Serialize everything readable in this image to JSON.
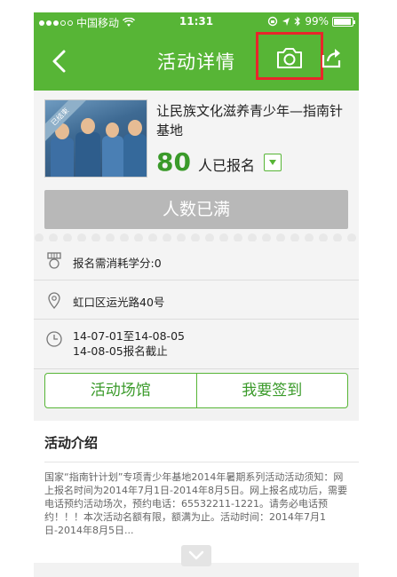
{
  "status_bar": {
    "carrier": "中国移动",
    "time": "11:31",
    "battery": "99%"
  },
  "nav": {
    "title": "活动详情",
    "back_icon": "chevron-left-icon",
    "camera_icon": "camera-icon",
    "share_icon": "share-icon"
  },
  "activity": {
    "thumb_ribbon": "已结束",
    "title": "让民族文化滋养青少年—指南针基地",
    "signup_count": "80",
    "signup_label": "人已报名",
    "full_button": "人数已满"
  },
  "info": {
    "credits": "报名需消耗学分:0",
    "address": "虹口区运光路40号",
    "date_range": "14-07-01至14-08-05",
    "deadline": "14-08-05报名截止"
  },
  "actions": {
    "venue": "活动场馆",
    "checkin": "我要签到"
  },
  "intro": {
    "title": "活动介绍",
    "text": "国家“指南针计划”专项青少年基地2014年暑期系列活动活动须知：网上报名时间为2014年7月1日-2014年8月5日。网上报名成功后，需要电话预约活动场次，预约电话：65532211-1221。请务必电话预约！！！本次活动名额有限，额满为止。活动时间：2014年7月1日-2014年8月5日..."
  },
  "colors": {
    "brand_green": "#57b536",
    "highlight_red": "#e8262b"
  }
}
